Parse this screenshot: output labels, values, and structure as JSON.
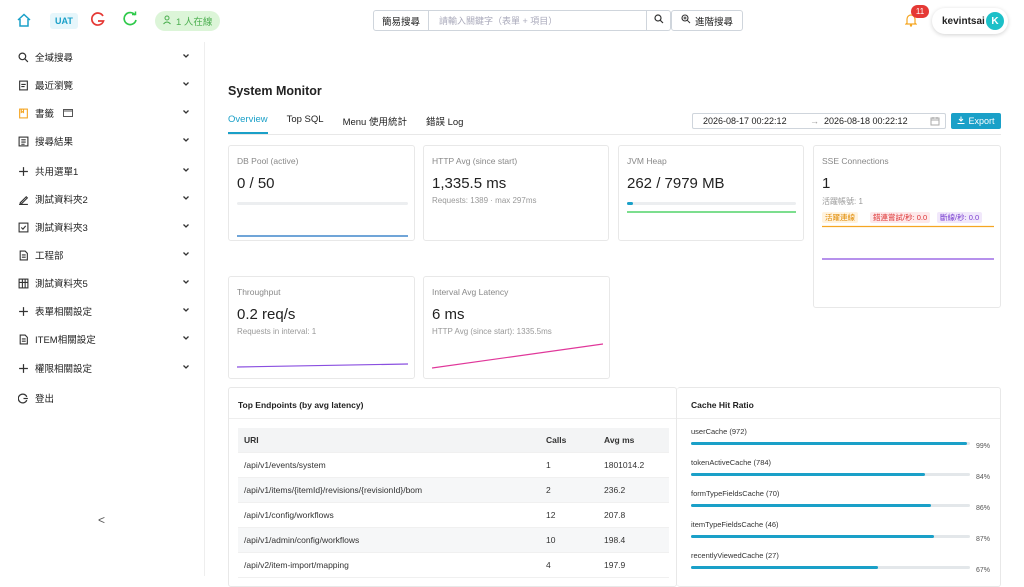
{
  "topbar": {
    "env_badge": "UAT",
    "online_text": "1 人在線",
    "search_mode": "簡易搜尋",
    "search_placeholder": "請輸入關鍵字（表單 + 項目）",
    "advanced_search": "進階搜尋",
    "notification_count": "11",
    "username": "kevintsai",
    "avatar_letter": "K"
  },
  "sidebar": {
    "items": [
      {
        "label": "全域搜尋",
        "icon": "search-icon"
      },
      {
        "label": "最近瀏覽",
        "icon": "history-icon"
      },
      {
        "label": "書籤",
        "icon": "bookmark-icon"
      },
      {
        "label": "搜尋結果",
        "icon": "list-icon"
      },
      {
        "label": "共用選單1",
        "icon": "plus-icon"
      },
      {
        "label": "測試資料夾2",
        "icon": "edit-icon"
      },
      {
        "label": "測試資料夾3",
        "icon": "checkbox-icon"
      },
      {
        "label": "工程部",
        "icon": "document-icon"
      },
      {
        "label": "測試資料夾5",
        "icon": "grid-icon"
      },
      {
        "label": "表單相關設定",
        "icon": "plus-icon"
      },
      {
        "label": "ITEM相關設定",
        "icon": "document-icon"
      },
      {
        "label": "權限相關設定",
        "icon": "plus-icon"
      },
      {
        "label": "登出",
        "icon": "logout-icon"
      }
    ],
    "collapse_label": "<"
  },
  "main": {
    "title": "System Monitor",
    "tabs": [
      {
        "label": "Overview",
        "active": true
      },
      {
        "label": "Top SQL",
        "active": false
      },
      {
        "label": "Menu 使用統計",
        "active": false
      },
      {
        "label": "錯誤 Log",
        "active": false
      }
    ],
    "date_from": "2026-08-17 00:22:12",
    "date_arrow": "→",
    "date_to": "2026-08-18 00:22:12",
    "export_label": "Export"
  },
  "cards": {
    "db_pool": {
      "title": "DB Pool (active)",
      "value": "0 / 50",
      "usage": 0.0
    },
    "http_avg": {
      "title": "HTTP Avg (since start)",
      "value": "1,335.5 ms",
      "sub": "Requests: 1389 · max 297ms"
    },
    "jvm_heap": {
      "title": "JVM Heap",
      "value": "262 / 7979 MB",
      "usage": 0.033
    },
    "sse": {
      "title": "SSE Connections",
      "value": "1",
      "sub": "活躍帳號: 1",
      "chip_active": "活躍連線",
      "chip_retry": "錯連嘗試/秒: 0.0",
      "chip_disconnect": "斷線/秒: 0.0"
    },
    "throughput": {
      "title": "Throughput",
      "value": "0.2 req/s",
      "sub": "Requests in interval: 1"
    },
    "interval_latency": {
      "title": "Interval Avg Latency",
      "value": "6 ms",
      "sub": "HTTP Avg (since start): 1335.5ms"
    }
  },
  "top_endpoints": {
    "title": "Top Endpoints (by avg latency)",
    "headers": {
      "uri": "URI",
      "calls": "Calls",
      "avg": "Avg ms"
    },
    "rows": [
      {
        "uri": "/api/v1/events/system",
        "calls": "1",
        "avg": "1801014.2"
      },
      {
        "uri": "/api/v1/items/{itemId}/revisions/{revisionId}/bom",
        "calls": "2",
        "avg": "236.2"
      },
      {
        "uri": "/api/v1/config/workflows",
        "calls": "12",
        "avg": "207.8"
      },
      {
        "uri": "/api/v1/admin/config/workflows",
        "calls": "10",
        "avg": "198.4"
      },
      {
        "uri": "/api/v2/item-import/mapping",
        "calls": "4",
        "avg": "197.9"
      }
    ]
  },
  "cache": {
    "title": "Cache Hit Ratio",
    "items": [
      {
        "label": "userCache (972)",
        "pct": 99,
        "pct_text": "99%"
      },
      {
        "label": "tokenActiveCache (784)",
        "pct": 84,
        "pct_text": "84%"
      },
      {
        "label": "formTypeFieldsCache (70)",
        "pct": 86,
        "pct_text": "86%"
      },
      {
        "label": "itemTypeFieldsCache (46)",
        "pct": 87,
        "pct_text": "87%"
      },
      {
        "label": "recentlyViewedCache (27)",
        "pct": 67,
        "pct_text": "67%"
      }
    ]
  },
  "colors": {
    "accent": "#1aa0c8",
    "online_green": "#4caf50",
    "badge_red": "#e53935",
    "jvm_line": "#2ec94a",
    "sse_line": "#8a4fe0",
    "throughput_line": "#8a4fe0",
    "latency_line": "#e0379a"
  }
}
